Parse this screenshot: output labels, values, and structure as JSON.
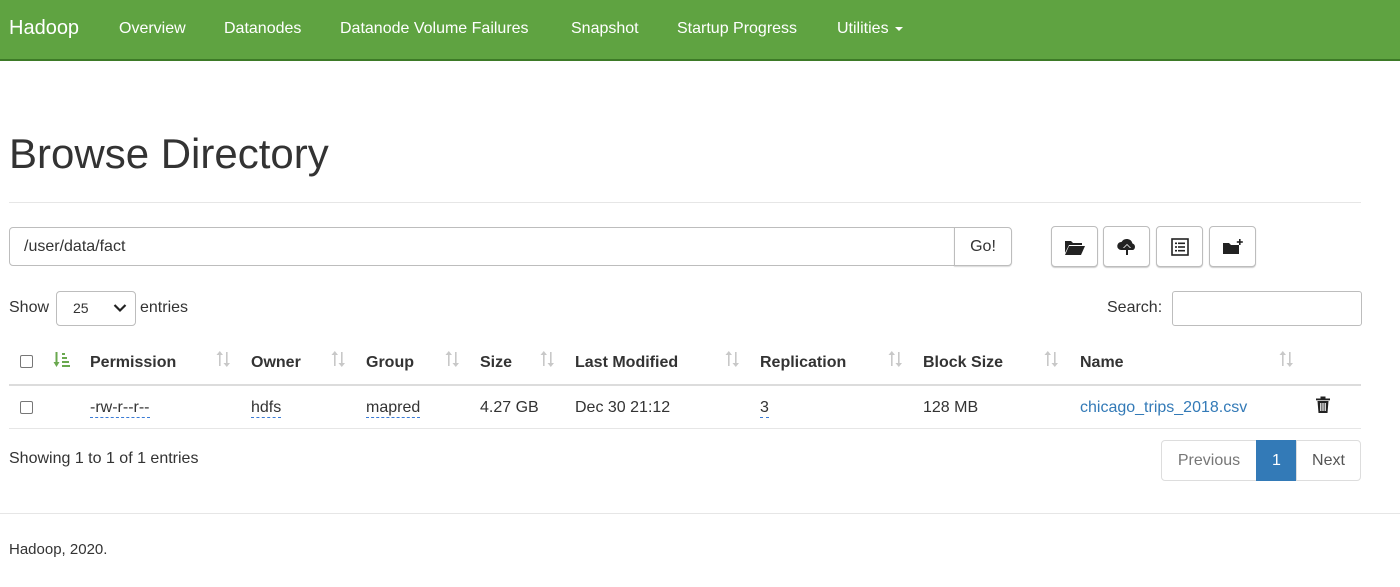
{
  "navbar": {
    "brand": "Hadoop",
    "items": [
      {
        "label": "Overview"
      },
      {
        "label": "Datanodes"
      },
      {
        "label": "Datanode Volume Failures"
      },
      {
        "label": "Snapshot"
      },
      {
        "label": "Startup Progress"
      },
      {
        "label": "Utilities",
        "has_dropdown": true
      }
    ],
    "color": "#5fa341"
  },
  "page": {
    "title": "Browse Directory"
  },
  "path_bar": {
    "value": "/user/data/fact",
    "go_label": "Go!"
  },
  "toolbar": {
    "icons": [
      "folder-open-icon",
      "cloud-upload-icon",
      "list-alt-icon",
      "new-folder-icon"
    ]
  },
  "table_controls": {
    "show_label": "Show",
    "page_length": "25",
    "entries_label": "entries",
    "search_label": "Search:",
    "search_value": ""
  },
  "table": {
    "columns": [
      "Permission",
      "Owner",
      "Group",
      "Size",
      "Last Modified",
      "Replication",
      "Block Size",
      "Name"
    ],
    "rows": [
      {
        "permission": "-rw-r--r--",
        "owner": "hdfs",
        "group": "mapred",
        "size": "4.27 GB",
        "last_modified": "Dec 30 21:12",
        "replication": "3",
        "block_size": "128 MB",
        "name": "chicago_trips_2018.csv"
      }
    ]
  },
  "pagination": {
    "info": "Showing 1 to 1 of 1 entries",
    "previous": "Previous",
    "current": "1",
    "next": "Next",
    "active_color": "#337ab7"
  },
  "footer": {
    "text": "Hadoop, 2020."
  }
}
